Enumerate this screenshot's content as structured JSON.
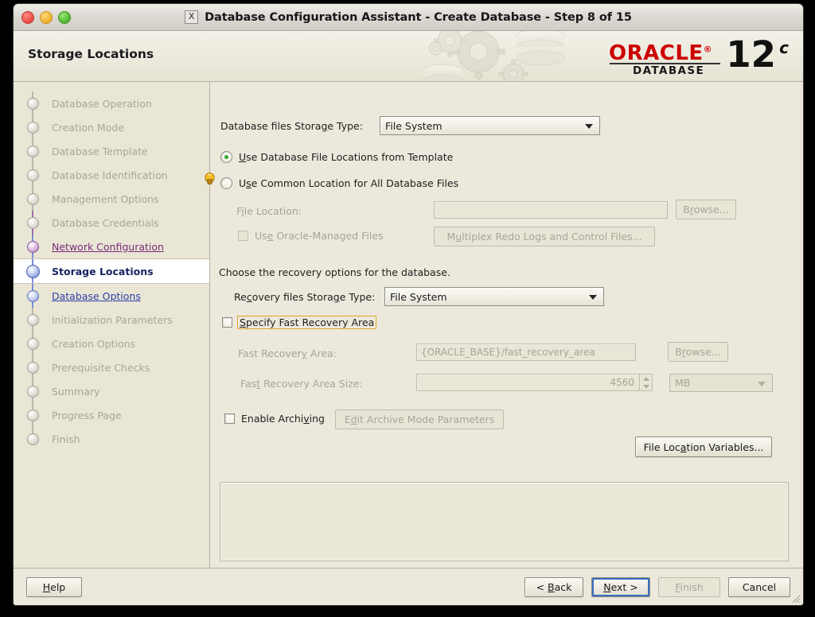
{
  "window": {
    "title": "Database Configuration Assistant - Create Database - Step 8 of 15",
    "x_icon": "X",
    "close_label": "close",
    "minimize_label": "minimize",
    "zoom_label": "zoom"
  },
  "banner": {
    "page_title": "Storage Locations",
    "brand": "ORACLE",
    "brand_tm": "®",
    "product": "DATABASE",
    "version_number": "12",
    "version_suffix": "c"
  },
  "sidebar": {
    "items": [
      {
        "label": "Database Operation",
        "state": "done"
      },
      {
        "label": "Creation Mode",
        "state": "done"
      },
      {
        "label": "Database Template",
        "state": "done"
      },
      {
        "label": "Database Identification",
        "state": "done"
      },
      {
        "label": "Management Options",
        "state": "done"
      },
      {
        "label": "Database Credentials",
        "state": "done"
      },
      {
        "label": "Network Configuration",
        "state": "visited"
      },
      {
        "label": "Storage Locations",
        "state": "current"
      },
      {
        "label": "Database Options",
        "state": "next"
      },
      {
        "label": "Initialization Parameters",
        "state": "done"
      },
      {
        "label": "Creation Options",
        "state": "done"
      },
      {
        "label": "Prerequisite Checks",
        "state": "done"
      },
      {
        "label": "Summary",
        "state": "done"
      },
      {
        "label": "Progress Page",
        "state": "done"
      },
      {
        "label": "Finish",
        "state": "done"
      }
    ]
  },
  "main": {
    "db_storage_type_label": "Database files Storage Type:",
    "db_storage_type_value": "File System",
    "radio_template_label": "Use Database File Locations from Template",
    "radio_common_label": "Use Common Location for All Database Files",
    "file_location_label": "File Location:",
    "file_location_value": "",
    "file_location_browse": "Browse...",
    "omf_checkbox_label": "Use Oracle-Managed Files",
    "multiplex_button": "Multiplex Redo Logs and Control Files...",
    "recovery_heading": "Choose the recovery options for the database.",
    "recovery_storage_type_label": "Recovery files Storage Type:",
    "recovery_storage_type_value": "File System",
    "specify_fra_label": "Specify Fast Recovery Area",
    "fra_label": "Fast Recovery Area:",
    "fra_value": "{ORACLE_BASE}/fast_recovery_area",
    "fra_browse": "Browse...",
    "fra_size_label": "Fast Recovery Area Size:",
    "fra_size_value": "4560",
    "fra_size_unit": "MB",
    "enable_archiving_label": "Enable Archiving",
    "edit_archive_button": "Edit Archive Mode Parameters",
    "file_location_variables_button": "File Location Variables...",
    "message_panel_text": ""
  },
  "footer": {
    "help": "Help",
    "back": "< Back",
    "next": "Next >",
    "finish": "Finish",
    "cancel": "Cancel"
  },
  "colors": {
    "window_bg": "#ece9dc",
    "sidebar_bg": "#e9e6d6",
    "accent_current": "#16225f",
    "link_visited": "#7b2a78",
    "link_next": "#2c3fa8",
    "oracle_red": "#cc0000",
    "focus_orange": "#e0a32b",
    "focus_blue": "#3b6fc4",
    "radio_dot_green": "#2faa2f"
  }
}
